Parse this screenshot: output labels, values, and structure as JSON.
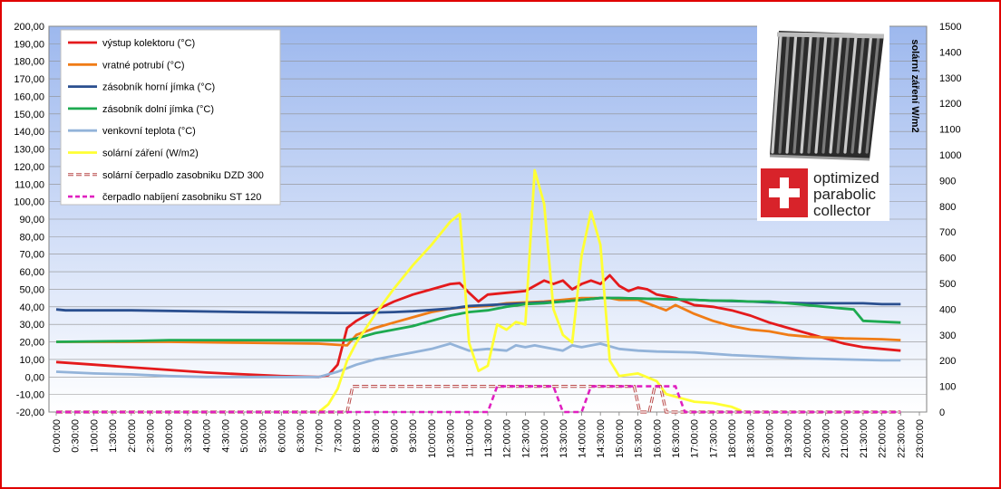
{
  "chart_data": {
    "type": "line",
    "y_left": {
      "min": -20,
      "max": 200,
      "step": 10
    },
    "y_right": {
      "label": "solární záření W/m2",
      "min": 0,
      "max": 1500,
      "step": 100
    },
    "grid": true,
    "legend_position": "top-left",
    "x_ticks": [
      "0:00:00",
      "0:30:00",
      "1:00:00",
      "1:30:00",
      "2:00:00",
      "2:30:00",
      "3:00:00",
      "3:30:00",
      "4:00:00",
      "4:30:00",
      "5:00:00",
      "5:30:00",
      "6:00:00",
      "6:30:00",
      "7:00:00",
      "7:30:00",
      "8:00:00",
      "8:30:00",
      "9:00:00",
      "9:30:00",
      "10:00:00",
      "10:30:00",
      "11:00:00",
      "11:30:00",
      "12:00:00",
      "12:30:00",
      "13:00:00",
      "13:30:00",
      "14:00:00",
      "14:30:00",
      "15:00:00",
      "15:30:00",
      "16:00:00",
      "16:30:00",
      "17:00:00",
      "17:30:00",
      "18:00:00",
      "18:30:00",
      "19:00:00",
      "19:30:00",
      "20:00:00",
      "20:30:00",
      "21:00:00",
      "21:30:00",
      "22:00:00",
      "22:30:00",
      "23:00:00"
    ],
    "series": [
      {
        "name": "výstup kolektoru (°C)",
        "color": "#e41a1c",
        "axis": "left",
        "style": "solid",
        "points": [
          [
            0,
            8.5
          ],
          [
            1,
            7
          ],
          [
            2,
            5.5
          ],
          [
            3,
            4
          ],
          [
            4,
            2.5
          ],
          [
            5,
            1.5
          ],
          [
            6,
            0.5
          ],
          [
            7,
            0
          ],
          [
            7.25,
            1
          ],
          [
            7.5,
            7
          ],
          [
            7.75,
            28
          ],
          [
            8,
            32
          ],
          [
            8.5,
            38
          ],
          [
            9,
            43
          ],
          [
            9.5,
            47
          ],
          [
            10,
            50
          ],
          [
            10.5,
            53
          ],
          [
            10.75,
            53.5
          ],
          [
            11,
            48
          ],
          [
            11.25,
            43
          ],
          [
            11.5,
            47
          ],
          [
            12,
            48
          ],
          [
            12.5,
            49
          ],
          [
            12.75,
            52
          ],
          [
            13,
            55
          ],
          [
            13.25,
            53
          ],
          [
            13.5,
            55
          ],
          [
            13.75,
            50
          ],
          [
            14,
            53
          ],
          [
            14.25,
            55
          ],
          [
            14.5,
            53
          ],
          [
            14.75,
            58
          ],
          [
            15,
            52
          ],
          [
            15.25,
            49
          ],
          [
            15.5,
            51
          ],
          [
            15.75,
            50
          ],
          [
            16,
            47
          ],
          [
            16.5,
            45
          ],
          [
            17,
            41
          ],
          [
            17.5,
            40
          ],
          [
            18,
            38
          ],
          [
            18.5,
            35
          ],
          [
            19,
            31
          ],
          [
            19.5,
            28
          ],
          [
            20,
            25
          ],
          [
            20.5,
            22
          ],
          [
            21,
            19
          ],
          [
            21.5,
            17
          ],
          [
            22,
            16
          ],
          [
            22.5,
            15
          ]
        ]
      },
      {
        "name": "vratné potrubí (°C)",
        "color": "#f07c16",
        "axis": "left",
        "style": "solid",
        "points": [
          [
            0,
            20
          ],
          [
            3,
            20
          ],
          [
            5,
            19.5
          ],
          [
            7,
            19
          ],
          [
            7.75,
            18
          ],
          [
            8,
            24
          ],
          [
            8.5,
            28
          ],
          [
            9,
            31
          ],
          [
            9.5,
            34
          ],
          [
            10,
            37
          ],
          [
            10.5,
            39
          ],
          [
            11,
            40
          ],
          [
            11.5,
            40.5
          ],
          [
            12,
            42
          ],
          [
            13,
            43
          ],
          [
            14,
            45
          ],
          [
            14.75,
            45
          ],
          [
            15,
            44
          ],
          [
            15.5,
            44
          ],
          [
            16,
            40
          ],
          [
            16.25,
            38
          ],
          [
            16.5,
            41
          ],
          [
            17,
            36
          ],
          [
            17.5,
            32
          ],
          [
            18,
            29
          ],
          [
            18.5,
            27
          ],
          [
            19,
            26
          ],
          [
            19.5,
            24
          ],
          [
            20,
            23
          ],
          [
            21,
            22
          ],
          [
            22,
            21.5
          ],
          [
            22.5,
            21
          ]
        ]
      },
      {
        "name": "zásobník horní jímka (°C)",
        "color": "#2a4f8f",
        "axis": "left",
        "style": "solid",
        "points": [
          [
            0,
            38.5
          ],
          [
            0.25,
            38
          ],
          [
            2,
            38
          ],
          [
            5,
            37
          ],
          [
            7.5,
            36.5
          ],
          [
            8,
            36.5
          ],
          [
            9,
            37
          ],
          [
            9.5,
            37.5
          ],
          [
            10.5,
            39
          ],
          [
            11,
            40.5
          ],
          [
            11.5,
            41
          ],
          [
            12.5,
            42
          ],
          [
            13.5,
            43
          ],
          [
            14,
            44
          ],
          [
            14.5,
            45
          ],
          [
            15,
            45
          ],
          [
            16,
            44.5
          ],
          [
            17,
            44
          ],
          [
            17.5,
            43.5
          ],
          [
            18.5,
            43
          ],
          [
            19,
            42.5
          ],
          [
            20,
            42
          ],
          [
            21.5,
            42
          ],
          [
            22,
            41.5
          ],
          [
            22.5,
            41.5
          ]
        ]
      },
      {
        "name": "zásobník dolní jímka (°C)",
        "color": "#1daa50",
        "axis": "left",
        "style": "solid",
        "points": [
          [
            0,
            20
          ],
          [
            2,
            20.5
          ],
          [
            3,
            21
          ],
          [
            5,
            21
          ],
          [
            6,
            21
          ],
          [
            7,
            21
          ],
          [
            7.75,
            21
          ],
          [
            8,
            22
          ],
          [
            8.5,
            25
          ],
          [
            9,
            27
          ],
          [
            9.5,
            29
          ],
          [
            10,
            32
          ],
          [
            10.5,
            35
          ],
          [
            11,
            37
          ],
          [
            11.5,
            38
          ],
          [
            12,
            40
          ],
          [
            12.5,
            41.5
          ],
          [
            13,
            42
          ],
          [
            13.5,
            43
          ],
          [
            14,
            44
          ],
          [
            14.5,
            45
          ],
          [
            15,
            45
          ],
          [
            16,
            44.5
          ],
          [
            17,
            44
          ],
          [
            17.5,
            43.5
          ],
          [
            18,
            43.5
          ],
          [
            18.5,
            43
          ],
          [
            19,
            43
          ],
          [
            19.5,
            42
          ],
          [
            20,
            41
          ],
          [
            21,
            39
          ],
          [
            21.25,
            38.5
          ],
          [
            21.5,
            32
          ],
          [
            22,
            31.5
          ],
          [
            22.5,
            31
          ]
        ]
      },
      {
        "name": "venkovní teplota (°C)",
        "color": "#93b3d9",
        "axis": "left",
        "style": "solid",
        "points": [
          [
            0,
            3
          ],
          [
            1,
            2
          ],
          [
            2,
            1.5
          ],
          [
            3,
            0.5
          ],
          [
            4,
            0
          ],
          [
            5,
            0
          ],
          [
            6,
            0
          ],
          [
            7,
            0
          ],
          [
            7.5,
            3
          ],
          [
            8,
            7
          ],
          [
            8.5,
            10
          ],
          [
            9,
            12
          ],
          [
            9.5,
            14
          ],
          [
            10,
            16
          ],
          [
            10.5,
            19
          ],
          [
            10.75,
            17
          ],
          [
            11,
            15
          ],
          [
            11.5,
            16
          ],
          [
            12,
            15
          ],
          [
            12.25,
            18
          ],
          [
            12.5,
            17
          ],
          [
            12.75,
            18
          ],
          [
            13,
            17
          ],
          [
            13.5,
            15
          ],
          [
            13.75,
            18
          ],
          [
            14,
            17
          ],
          [
            14.5,
            19
          ],
          [
            15,
            16
          ],
          [
            15.5,
            15
          ],
          [
            16,
            14.5
          ],
          [
            17,
            14
          ],
          [
            18,
            12.5
          ],
          [
            19,
            11.5
          ],
          [
            20,
            10.5
          ],
          [
            21,
            10
          ],
          [
            22,
            9.5
          ],
          [
            22.5,
            9.5
          ]
        ]
      },
      {
        "name": "solární záření (W/m2)",
        "color": "#ffff33",
        "axis": "right",
        "style": "solid",
        "points": [
          [
            7,
            0
          ],
          [
            7.25,
            30
          ],
          [
            7.5,
            90
          ],
          [
            7.75,
            200
          ],
          [
            8,
            270
          ],
          [
            8.5,
            380
          ],
          [
            9,
            480
          ],
          [
            9.5,
            570
          ],
          [
            10,
            650
          ],
          [
            10.5,
            740
          ],
          [
            10.75,
            770
          ],
          [
            11,
            270
          ],
          [
            11.25,
            160
          ],
          [
            11.5,
            180
          ],
          [
            11.75,
            340
          ],
          [
            12,
            320
          ],
          [
            12.25,
            350
          ],
          [
            12.5,
            340
          ],
          [
            12.75,
            940
          ],
          [
            13,
            810
          ],
          [
            13.25,
            400
          ],
          [
            13.5,
            300
          ],
          [
            13.75,
            270
          ],
          [
            14,
            610
          ],
          [
            14.25,
            780
          ],
          [
            14.5,
            650
          ],
          [
            14.75,
            200
          ],
          [
            15,
            140
          ],
          [
            15.5,
            150
          ],
          [
            16,
            120
          ],
          [
            16.25,
            70
          ],
          [
            16.5,
            60
          ],
          [
            16.75,
            50
          ],
          [
            17,
            40
          ],
          [
            17.5,
            35
          ],
          [
            18,
            20
          ],
          [
            18.25,
            5
          ]
        ]
      },
      {
        "name": "solární čerpadlo zasobniku  DZD 300",
        "color": "#b94a4a",
        "axis": "right",
        "style": "dash-double",
        "points": [
          [
            0,
            0
          ],
          [
            7.75,
            0
          ],
          [
            7.9,
            100
          ],
          [
            15.4,
            100
          ],
          [
            15.55,
            0
          ],
          [
            15.8,
            0
          ],
          [
            15.95,
            100
          ],
          [
            16.1,
            100
          ],
          [
            16.25,
            0
          ],
          [
            22.5,
            0
          ]
        ]
      },
      {
        "name": "čerpadlo nabíjení  zasobniku ST 120",
        "color": "#e020c0",
        "axis": "right",
        "style": "dash",
        "points": [
          [
            0,
            0
          ],
          [
            11.5,
            0
          ],
          [
            11.75,
            100
          ],
          [
            13.25,
            100
          ],
          [
            13.5,
            0
          ],
          [
            14,
            0
          ],
          [
            14.25,
            100
          ],
          [
            16.5,
            100
          ],
          [
            16.75,
            0
          ],
          [
            22.5,
            0
          ]
        ]
      }
    ]
  },
  "logo": {
    "text": [
      "optimized",
      "parabolic",
      "collector"
    ],
    "brand_color": "#d8232a"
  }
}
